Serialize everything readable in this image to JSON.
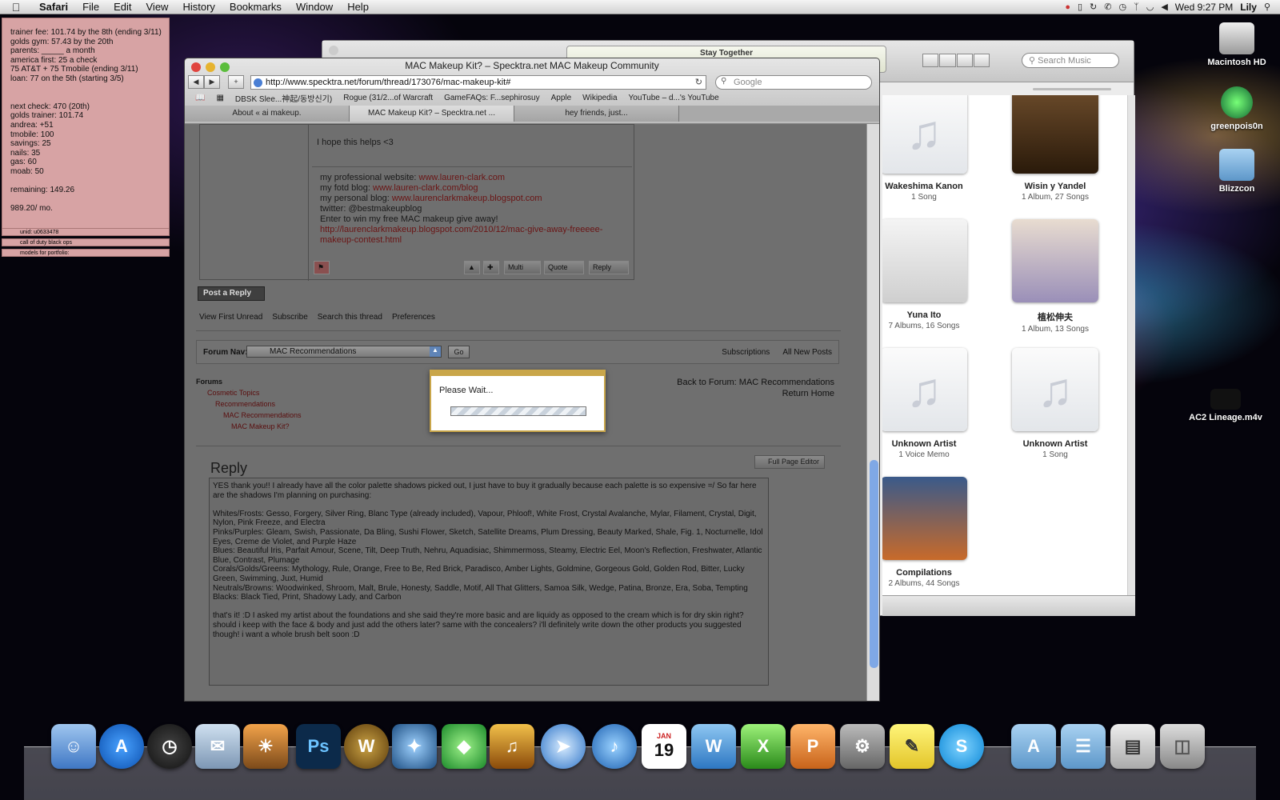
{
  "menubar": {
    "app": "Safari",
    "items": [
      "File",
      "Edit",
      "View",
      "History",
      "Bookmarks",
      "Window",
      "Help"
    ],
    "clock": "Wed 9:27 PM",
    "user": "Lily"
  },
  "sticky": {
    "lines": [
      "trainer fee: 101.74 by the 8th (ending 3/11)",
      "golds gym: 57.43 by the 20th",
      "parents: _____ a month",
      "america first: 25 a check",
      "75 AT&T + 75 Tmobile (ending 3/11)",
      "loan: 77 on the 5th (starting 3/5)",
      "",
      "",
      "next check: 470 (20th)",
      "golds trainer: 101.74",
      "andrea: +51",
      "tmobile: 100",
      "savings: 25",
      "nails: 35",
      "gas: 60",
      "moab: 50",
      "",
      "remaining: 149.26",
      "",
      "989.20/ mo."
    ],
    "tabs": [
      "unid: u0633478",
      "call of duty black ops",
      "models for portfolio:"
    ]
  },
  "itunes": {
    "now_playing": "Stay Together",
    "search_placeholder": "Search Music",
    "albums": [
      {
        "name": "Wakeshima Kanon",
        "count": "1 Song"
      },
      {
        "name": "Wisin y Yandel",
        "count": "1 Album, 27 Songs"
      },
      {
        "name": "Yuna Ito",
        "count": "7 Albums, 16 Songs"
      },
      {
        "name": "植松伸夫",
        "count": "1 Album, 13 Songs"
      },
      {
        "name": "Unknown Artist",
        "count": "1 Voice Memo"
      },
      {
        "name": "Unknown Artist",
        "count": "1 Song"
      },
      {
        "name": "Compilations",
        "count": "2 Albums, 44 Songs"
      }
    ]
  },
  "safari": {
    "title": "MAC Makeup Kit? – Specktra.net MAC Makeup Community",
    "url": "http://www.specktra.net/forum/thread/173076/mac-makeup-kit#",
    "search_placeholder": "Google",
    "bookmarks": [
      "DBSK Slee...神起/동방신기)",
      "Rogue (31/2...of Warcraft",
      "GameFAQs: F...sephirosuy",
      "Apple",
      "Wikipedia",
      "YouTube – d...'s YouTube"
    ],
    "tabs": [
      "About « ai makeup.",
      "MAC Makeup Kit? – Specktra.net ...",
      "hey friends, just..."
    ]
  },
  "forum": {
    "post_text": "I hope this helps <3",
    "sig": [
      {
        "pre": "my professional website: ",
        "link": "www.lauren-clark.com"
      },
      {
        "pre": "my fotd blog: ",
        "link": "www.lauren-clark.com/blog"
      },
      {
        "pre": "my personal blog: ",
        "link": "www.laurenclarkmakeup.blogspot.com"
      },
      {
        "pre": "twitter: @bestmakeupblog",
        "link": ""
      },
      {
        "pre": " Enter to win my free MAC makeup give away! ",
        "link": "http://laurenclarkmakeup.blogspot.com/2010/12/mac-give-away-freeeee-makeup-contest.html"
      }
    ],
    "post_buttons": [
      "Multi",
      "Quote",
      "Reply"
    ],
    "post_reply": "Post a Reply",
    "thread_links": [
      "View First Unread",
      "Subscribe",
      "Search this thread",
      "Preferences"
    ],
    "nav_label": "Forum Nav:",
    "nav_selected": "MAC Recommendations",
    "go": "Go",
    "nav_right": [
      "Subscriptions",
      "All New Posts"
    ],
    "crumbs": [
      "Forums",
      "Cosmetic Topics",
      "Recommendations",
      "MAC Recommendations",
      "MAC Makeup Kit?"
    ],
    "back": "Back to Forum: MAC Recommendations",
    "home": "Return Home",
    "wait": "Please Wait...",
    "reply_heading": "Reply",
    "full_editor": "Full Page Editor",
    "reply_paras": [
      "YES thank you!! I already have all the color palette shadows picked out, I just have to buy it gradually because each palette is so expensive =/ So far here are the shadows I'm planning on purchasing:",
      "Whites/Frosts: Gesso, Forgery, Silver Ring, Blanc Type (already included), Vapour, Phloof!, White Frost, Crystal Avalanche, Mylar, Filament, Crystal, Digit, Nylon, Pink Freeze, and Electra\nPinks/Purples: Gleam, Swish, Passionate, Da Bling, Sushi Flower, Sketch, Satellite Dreams, Plum Dressing, Beauty Marked, Shale, Fig. 1, Nocturnelle, Idol Eyes, Creme de Violet, and Purple Haze\nBlues: Beautiful Iris, Parfait Amour, Scene, Tilt, Deep Truth, Nehru, Aquadisiac, Shimmermoss, Steamy, Electric Eel, Moon's Reflection, Freshwater, Atlantic Blue, Contrast, Plumage\nCorals/Golds/Greens: Mythology, Rule, Orange, Free to Be, Red Brick, Paradisco, Amber Lights, Goldmine, Gorgeous Gold, Golden Rod, Bitter, Lucky Green, Swimming, Juxt, Humid\nNeutrals/Browns: Woodwinked, Shroom, Malt, Brule, Honesty, Saddle, Motif, All That Glitters, Samoa Silk, Wedge, Patina, Bronze, Era, Soba, Tempting\nBlacks: Black Tied, Print, Shadowy Lady, and Carbon",
      "that's it! :D I asked my artist about the foundations and she said they're more basic and are liquidy as opposed to the cream which is for dry skin right? should i keep with the face & body and just add the others later? same with the concealers? i'll definitely write down the other products you suggested though! i want a whole brush belt soon :D"
    ]
  },
  "desktop": [
    {
      "name": "Macintosh HD"
    },
    {
      "name": "greenpois0n"
    },
    {
      "name": "Blizzcon"
    },
    {
      "name": "AC2 Lineage.m4v"
    }
  ],
  "dock_calendar": {
    "month": "JAN",
    "day": "19"
  }
}
